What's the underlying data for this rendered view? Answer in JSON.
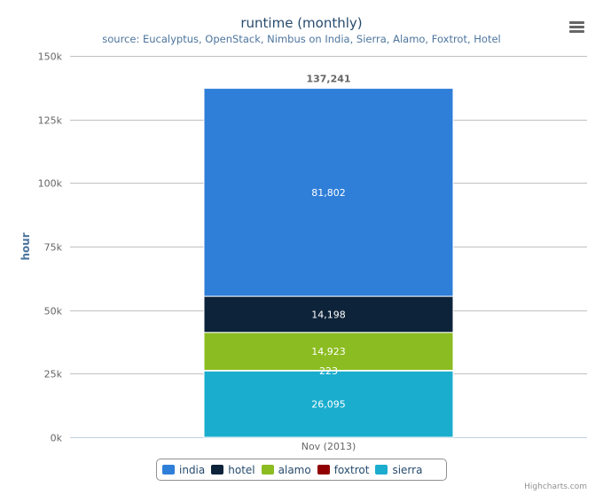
{
  "header": {
    "title": "runtime (monthly)",
    "subtitle": "source: Eucalyptus, OpenStack, Nimbus on India, Sierra, Alamo, Foxtrot, Hotel"
  },
  "menu": {
    "icon": "hamburger-menu-icon"
  },
  "credits": "Highcharts.com",
  "chart_data": {
    "type": "bar",
    "stacked": true,
    "title": "runtime (monthly)",
    "subtitle": "source: Eucalyptus, OpenStack, Nimbus on India, Sierra, Alamo, Foxtrot, Hotel",
    "xlabel": "",
    "ylabel": "hour",
    "categories": [
      "Nov (2013)"
    ],
    "ylim": [
      0,
      150000
    ],
    "yticks": [
      0,
      25000,
      50000,
      75000,
      100000,
      125000,
      150000
    ],
    "ytick_labels": [
      "0k",
      "25k",
      "50k",
      "75k",
      "100k",
      "125k",
      "150k"
    ],
    "grid": true,
    "legend_position": "bottom-center",
    "stack_totals": [
      "137,241"
    ],
    "series": [
      {
        "name": "india",
        "color": "#2f7ed8",
        "values": [
          81802
        ],
        "label": "81,802"
      },
      {
        "name": "hotel",
        "color": "#0d233a",
        "values": [
          14198
        ],
        "label": "14,198"
      },
      {
        "name": "alamo",
        "color": "#8bbc21",
        "values": [
          14923
        ],
        "label": "14,923"
      },
      {
        "name": "foxtrot",
        "color": "#910000",
        "values": [
          223
        ],
        "label": "223"
      },
      {
        "name": "sierra",
        "color": "#1aadce",
        "values": [
          26095
        ],
        "label": "26,095"
      }
    ]
  }
}
